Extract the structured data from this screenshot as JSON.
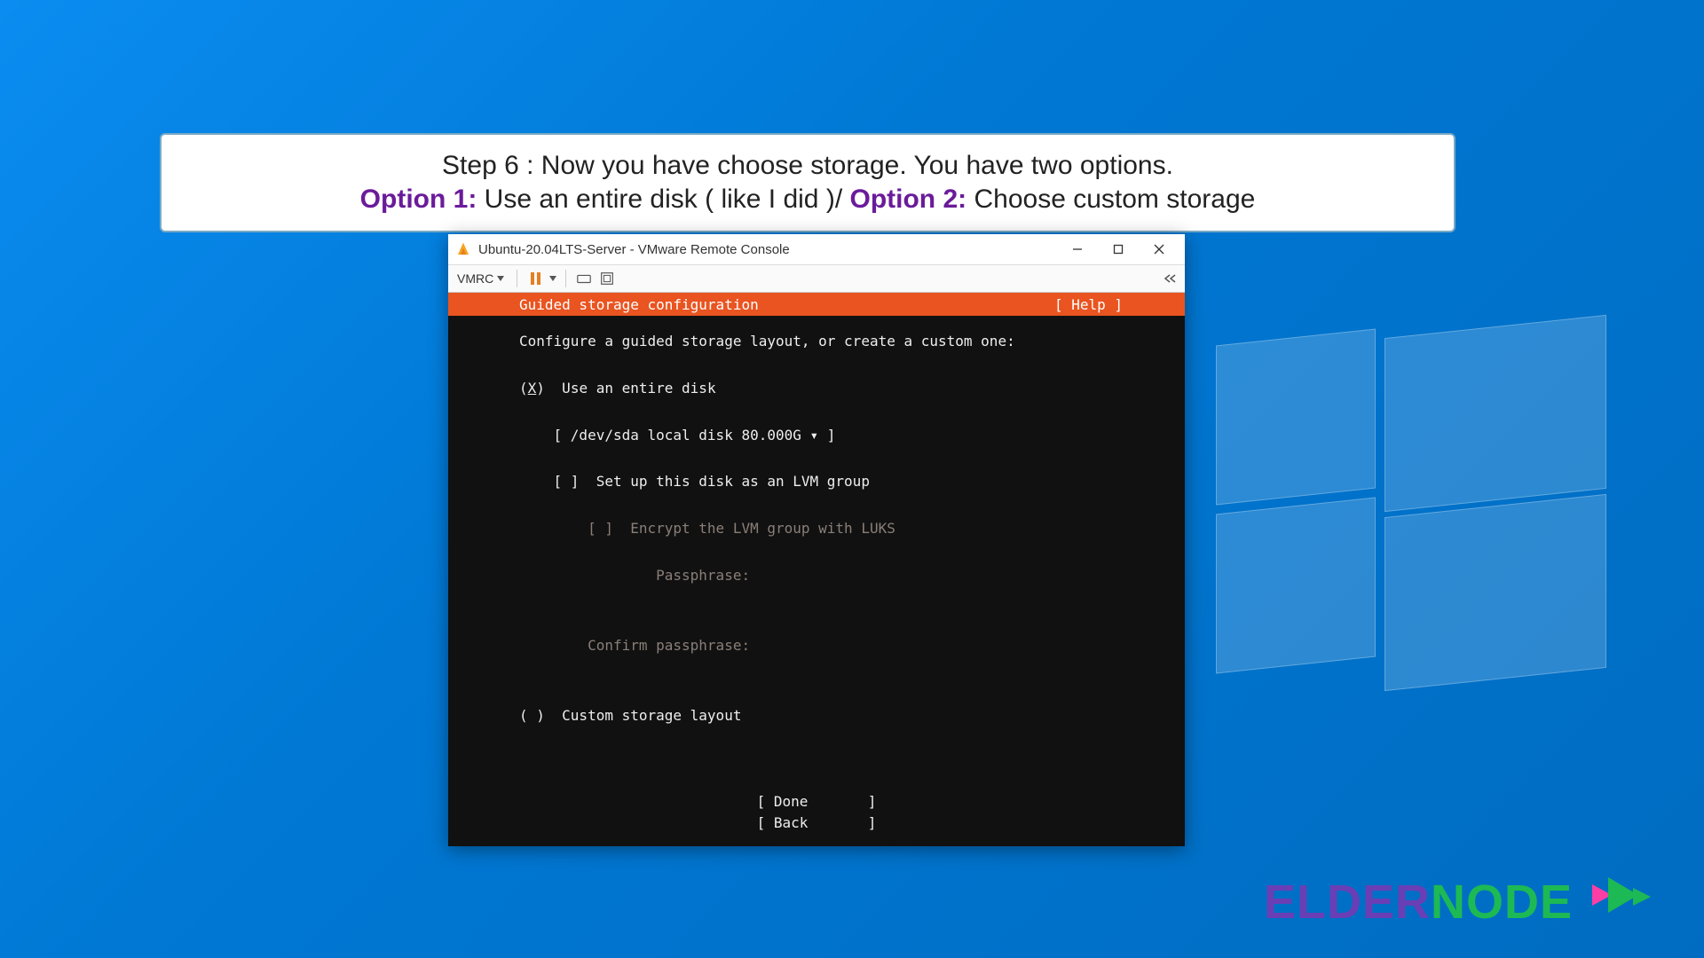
{
  "banner": {
    "line1": "Step 6 : Now you have choose storage. You have two options.",
    "opt1_label": "Option 1:",
    "opt1_text": " Use an entire disk ( like I did )/ ",
    "opt2_label": "Option 2:",
    "opt2_text": " Choose custom storage"
  },
  "window": {
    "title": "Ubuntu-20.04LTS-Server - VMware Remote Console"
  },
  "toolbar": {
    "vmrc_label": "VMRC"
  },
  "installer": {
    "header_title": "Guided storage configuration",
    "header_help": "[ Help ]",
    "prompt": "Configure a guided storage layout, or create a custom one:",
    "radio_selected_prefix": "(",
    "radio_selected_char": "X",
    "radio_selected_suffix": ")  Use an entire disk",
    "disk_line": "[ /dev/sda local disk 80.000G ▾ ]",
    "lvm_line": "[ ]  Set up this disk as an LVM group",
    "encrypt_line": "[ ]  Encrypt the LVM group with LUKS",
    "passphrase_label": "Passphrase:",
    "confirm_label": "Confirm passphrase:",
    "custom_line": "( )  Custom storage layout",
    "done": "[ Done       ]",
    "back": "[ Back       ]"
  },
  "brand": {
    "elder": "ELDER",
    "node": "NODE"
  }
}
